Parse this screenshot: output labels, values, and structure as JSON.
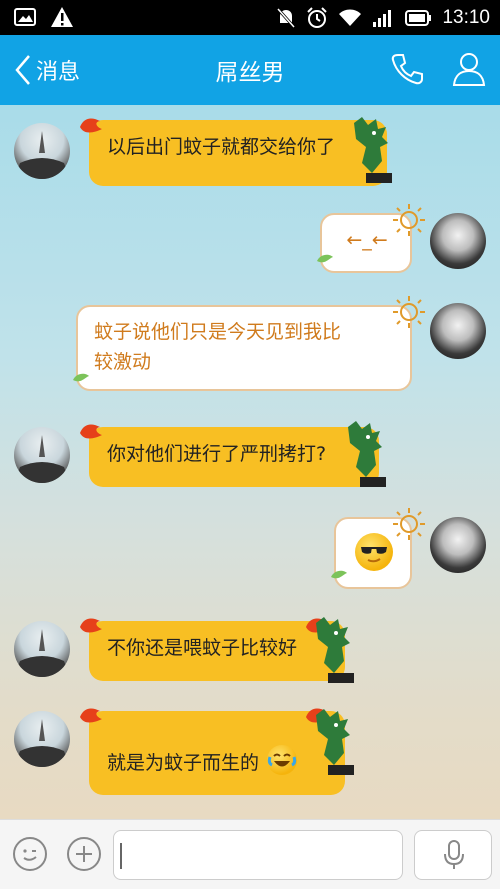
{
  "status_bar": {
    "time": "13:10",
    "icons": [
      "image-icon",
      "warning-icon",
      "mute-icon",
      "alarm-icon",
      "wifi-icon",
      "signal-icon",
      "battery-icon"
    ]
  },
  "header": {
    "back_label": "消息",
    "title": "屌丝男",
    "icons": [
      "back-chevron-icon",
      "phone-icon",
      "person-icon"
    ],
    "color": "#11a3e5"
  },
  "messages": [
    {
      "side": "left",
      "text": "以后出门蚊子就都交给你了"
    },
    {
      "side": "right",
      "text": "←_←"
    },
    {
      "side": "right",
      "lines": [
        "蚊子说他们只是今天见到我比",
        "较激动"
      ]
    },
    {
      "side": "left",
      "text": "你对他们进行了严刑拷打?"
    },
    {
      "side": "right",
      "emoji": "sunglasses-face"
    },
    {
      "side": "left",
      "text": "不你还是喂蚊子比较好"
    },
    {
      "side": "left",
      "text": "就是为蚊子而生的",
      "emoji": "laughing-tears-face"
    }
  ],
  "input_bar": {
    "icons": [
      "emoji-icon",
      "plus-icon",
      "microphone-icon"
    ],
    "value": "",
    "placeholder": ""
  },
  "colors": {
    "left_bubble": "#f8bf23",
    "right_bubble_text": "#d07b1d"
  }
}
